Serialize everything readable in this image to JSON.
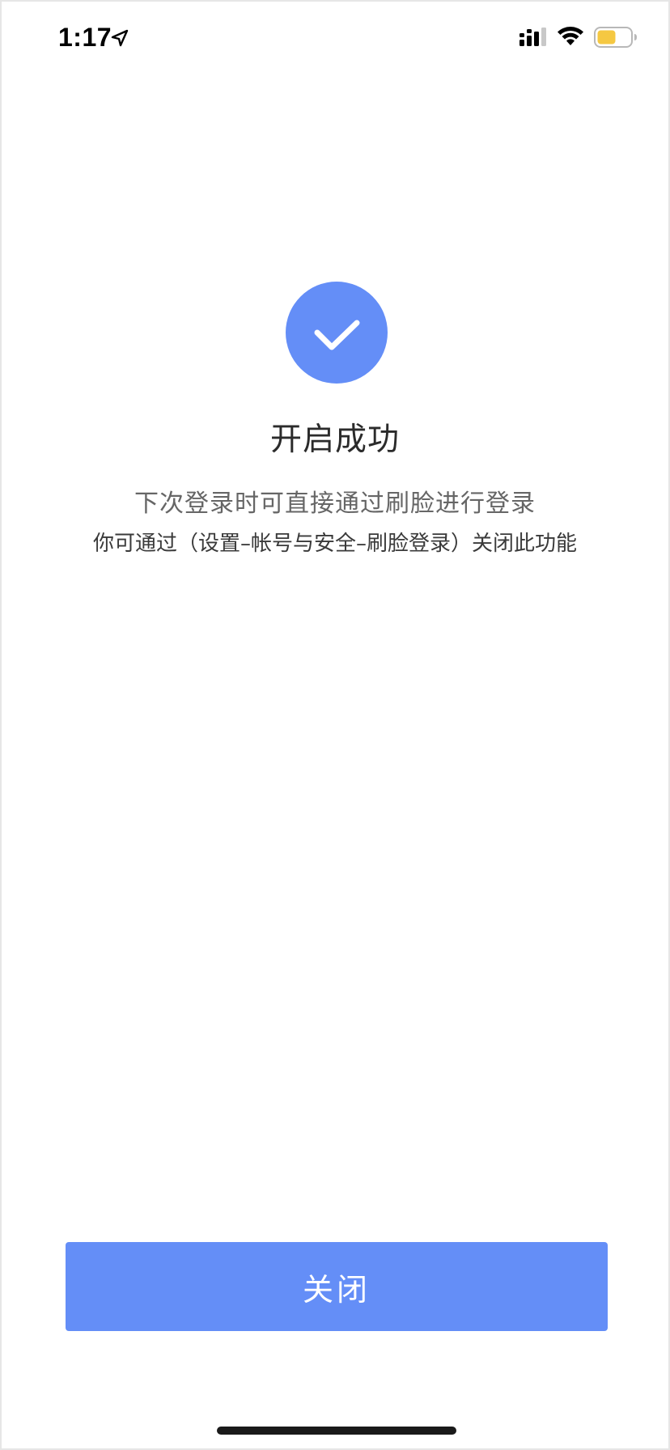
{
  "status_bar": {
    "time": "1:17",
    "icons": [
      "location-arrow-icon",
      "cellular-signal-icon",
      "wifi-icon",
      "battery-icon"
    ],
    "battery_color": "#f5c842"
  },
  "success": {
    "icon": "checkmark-icon",
    "accent_color": "#648ef7",
    "title": "开启成功",
    "description_line1": "下次登录时可直接通过刷脸进行登录",
    "description_line2": "你可通过（设置–帐号与安全–刷脸登录）关闭此功能"
  },
  "actions": {
    "close_label": "关闭"
  }
}
